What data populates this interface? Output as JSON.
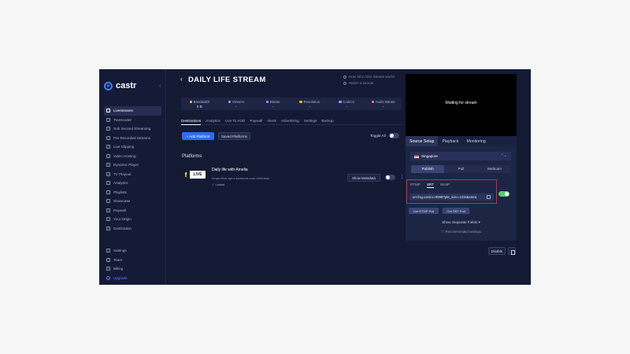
{
  "brand": {
    "name": "castr"
  },
  "sidebar": {
    "collapse_glyph": "‹",
    "items": [
      {
        "label": "Livestreams",
        "icon": "camera-icon",
        "active": true
      },
      {
        "label": "Transcoder",
        "icon": "transcoder-icon"
      },
      {
        "label": "Sub Second Streaming",
        "icon": "bolt-icon"
      },
      {
        "label": "Pre-Recorded Streams",
        "icon": "film-icon"
      },
      {
        "label": "Live Clipping",
        "icon": "clip-icon"
      },
      {
        "label": "Video Hosting",
        "icon": "video-icon"
      },
      {
        "label": "Dynamic Player",
        "icon": "player-icon"
      },
      {
        "label": "TV Playout",
        "icon": "tv-icon"
      },
      {
        "label": "Analytics",
        "icon": "chart-icon"
      },
      {
        "label": "Playlists",
        "icon": "playlist-icon"
      },
      {
        "label": "Showcase",
        "icon": "showcase-icon"
      },
      {
        "label": "Paywall",
        "icon": "wallet-icon"
      },
      {
        "label": "Your Origin",
        "icon": "origin-icon"
      },
      {
        "label": "Destination",
        "icon": "destination-icon"
      }
    ],
    "bottom_items": [
      {
        "label": "Settings",
        "icon": "gear-icon"
      },
      {
        "label": "Team",
        "icon": "team-icon"
      },
      {
        "label": "Billing",
        "icon": "billing-icon"
      },
      {
        "label": "Upgrade",
        "icon": "upgrade-icon"
      }
    ]
  },
  "header": {
    "back_glyph": "‹",
    "title": "DAILY LIFE STREAM",
    "help_how": "How All in One Stream works",
    "help_tutorial": "Watch a tutorial"
  },
  "stats": [
    {
      "label": "Bandwidth",
      "value": "0 B",
      "color": "#f5b342"
    },
    {
      "label": "Viewers",
      "value": "-",
      "color": "#7aa7ff"
    },
    {
      "label": "Bitrate",
      "value": "-",
      "color": "#b57bff"
    },
    {
      "label": "Resolution",
      "value": "-",
      "color": "#f5b342"
    },
    {
      "label": "Codecs",
      "value": "-",
      "color": "#7aa7ff"
    },
    {
      "label": "Audio Bitrate",
      "value": "-",
      "color": "#ff6b8a"
    }
  ],
  "tabs": [
    "Destinations",
    "Analytics",
    "Live To VOD",
    "Paywall",
    "Alerts",
    "Advertising",
    "Settings",
    "Backup"
  ],
  "actions": {
    "add_platform": "+ Add Platform",
    "saved_platforms": "Saved Platforms",
    "toggle_all": "Toggle All"
  },
  "platforms": {
    "title": "Platforms",
    "item": {
      "logo_letter": "f",
      "logo_text": "LIVE",
      "name": "Daily life with Amelia",
      "url": "rtmps://live-api-s.facebook.com:443/rtmp/",
      "status": "✓ Linked",
      "show_metadata": "Show Metadata",
      "more_glyph": "⋮"
    }
  },
  "right_panel": {
    "video_status": "Waiting for stream",
    "tabs": [
      "Source Setup",
      "Playback",
      "Monitoring"
    ],
    "region": "Singapore",
    "region_chevron": "⌃⌄",
    "modes": [
      "Publish",
      "Pull",
      "Webcam"
    ],
    "protocols": [
      "RTMP",
      "SRT",
      "WHIP"
    ],
    "srt_url": "srt://sg.castr.io:9998?pkt_size=1316&strea",
    "get_rtmp_pull": "Get RTMP Pull",
    "get_srt_pull": "Get SRT Pull",
    "show_separate": "Show Separate Fields ▾",
    "recommended": "ⓘ Recommended settings"
  },
  "footer": {
    "disable": "Disable"
  },
  "colors": {
    "accent": "#2f6cf0",
    "highlight": "#d12f2f",
    "toggle_on": "#4ccf6b"
  }
}
